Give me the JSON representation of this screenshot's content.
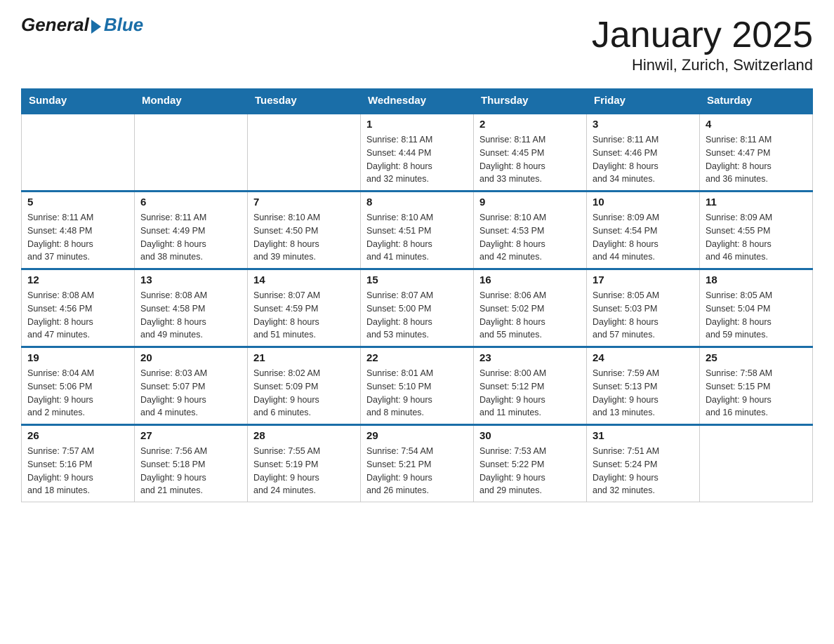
{
  "header": {
    "logo_general": "General",
    "logo_blue": "Blue",
    "month_title": "January 2025",
    "location": "Hinwil, Zurich, Switzerland"
  },
  "days_of_week": [
    "Sunday",
    "Monday",
    "Tuesday",
    "Wednesday",
    "Thursday",
    "Friday",
    "Saturday"
  ],
  "weeks": [
    {
      "days": [
        {
          "number": "",
          "info": ""
        },
        {
          "number": "",
          "info": ""
        },
        {
          "number": "",
          "info": ""
        },
        {
          "number": "1",
          "info": "Sunrise: 8:11 AM\nSunset: 4:44 PM\nDaylight: 8 hours\nand 32 minutes."
        },
        {
          "number": "2",
          "info": "Sunrise: 8:11 AM\nSunset: 4:45 PM\nDaylight: 8 hours\nand 33 minutes."
        },
        {
          "number": "3",
          "info": "Sunrise: 8:11 AM\nSunset: 4:46 PM\nDaylight: 8 hours\nand 34 minutes."
        },
        {
          "number": "4",
          "info": "Sunrise: 8:11 AM\nSunset: 4:47 PM\nDaylight: 8 hours\nand 36 minutes."
        }
      ]
    },
    {
      "days": [
        {
          "number": "5",
          "info": "Sunrise: 8:11 AM\nSunset: 4:48 PM\nDaylight: 8 hours\nand 37 minutes."
        },
        {
          "number": "6",
          "info": "Sunrise: 8:11 AM\nSunset: 4:49 PM\nDaylight: 8 hours\nand 38 minutes."
        },
        {
          "number": "7",
          "info": "Sunrise: 8:10 AM\nSunset: 4:50 PM\nDaylight: 8 hours\nand 39 minutes."
        },
        {
          "number": "8",
          "info": "Sunrise: 8:10 AM\nSunset: 4:51 PM\nDaylight: 8 hours\nand 41 minutes."
        },
        {
          "number": "9",
          "info": "Sunrise: 8:10 AM\nSunset: 4:53 PM\nDaylight: 8 hours\nand 42 minutes."
        },
        {
          "number": "10",
          "info": "Sunrise: 8:09 AM\nSunset: 4:54 PM\nDaylight: 8 hours\nand 44 minutes."
        },
        {
          "number": "11",
          "info": "Sunrise: 8:09 AM\nSunset: 4:55 PM\nDaylight: 8 hours\nand 46 minutes."
        }
      ]
    },
    {
      "days": [
        {
          "number": "12",
          "info": "Sunrise: 8:08 AM\nSunset: 4:56 PM\nDaylight: 8 hours\nand 47 minutes."
        },
        {
          "number": "13",
          "info": "Sunrise: 8:08 AM\nSunset: 4:58 PM\nDaylight: 8 hours\nand 49 minutes."
        },
        {
          "number": "14",
          "info": "Sunrise: 8:07 AM\nSunset: 4:59 PM\nDaylight: 8 hours\nand 51 minutes."
        },
        {
          "number": "15",
          "info": "Sunrise: 8:07 AM\nSunset: 5:00 PM\nDaylight: 8 hours\nand 53 minutes."
        },
        {
          "number": "16",
          "info": "Sunrise: 8:06 AM\nSunset: 5:02 PM\nDaylight: 8 hours\nand 55 minutes."
        },
        {
          "number": "17",
          "info": "Sunrise: 8:05 AM\nSunset: 5:03 PM\nDaylight: 8 hours\nand 57 minutes."
        },
        {
          "number": "18",
          "info": "Sunrise: 8:05 AM\nSunset: 5:04 PM\nDaylight: 8 hours\nand 59 minutes."
        }
      ]
    },
    {
      "days": [
        {
          "number": "19",
          "info": "Sunrise: 8:04 AM\nSunset: 5:06 PM\nDaylight: 9 hours\nand 2 minutes."
        },
        {
          "number": "20",
          "info": "Sunrise: 8:03 AM\nSunset: 5:07 PM\nDaylight: 9 hours\nand 4 minutes."
        },
        {
          "number": "21",
          "info": "Sunrise: 8:02 AM\nSunset: 5:09 PM\nDaylight: 9 hours\nand 6 minutes."
        },
        {
          "number": "22",
          "info": "Sunrise: 8:01 AM\nSunset: 5:10 PM\nDaylight: 9 hours\nand 8 minutes."
        },
        {
          "number": "23",
          "info": "Sunrise: 8:00 AM\nSunset: 5:12 PM\nDaylight: 9 hours\nand 11 minutes."
        },
        {
          "number": "24",
          "info": "Sunrise: 7:59 AM\nSunset: 5:13 PM\nDaylight: 9 hours\nand 13 minutes."
        },
        {
          "number": "25",
          "info": "Sunrise: 7:58 AM\nSunset: 5:15 PM\nDaylight: 9 hours\nand 16 minutes."
        }
      ]
    },
    {
      "days": [
        {
          "number": "26",
          "info": "Sunrise: 7:57 AM\nSunset: 5:16 PM\nDaylight: 9 hours\nand 18 minutes."
        },
        {
          "number": "27",
          "info": "Sunrise: 7:56 AM\nSunset: 5:18 PM\nDaylight: 9 hours\nand 21 minutes."
        },
        {
          "number": "28",
          "info": "Sunrise: 7:55 AM\nSunset: 5:19 PM\nDaylight: 9 hours\nand 24 minutes."
        },
        {
          "number": "29",
          "info": "Sunrise: 7:54 AM\nSunset: 5:21 PM\nDaylight: 9 hours\nand 26 minutes."
        },
        {
          "number": "30",
          "info": "Sunrise: 7:53 AM\nSunset: 5:22 PM\nDaylight: 9 hours\nand 29 minutes."
        },
        {
          "number": "31",
          "info": "Sunrise: 7:51 AM\nSunset: 5:24 PM\nDaylight: 9 hours\nand 32 minutes."
        },
        {
          "number": "",
          "info": ""
        }
      ]
    }
  ]
}
